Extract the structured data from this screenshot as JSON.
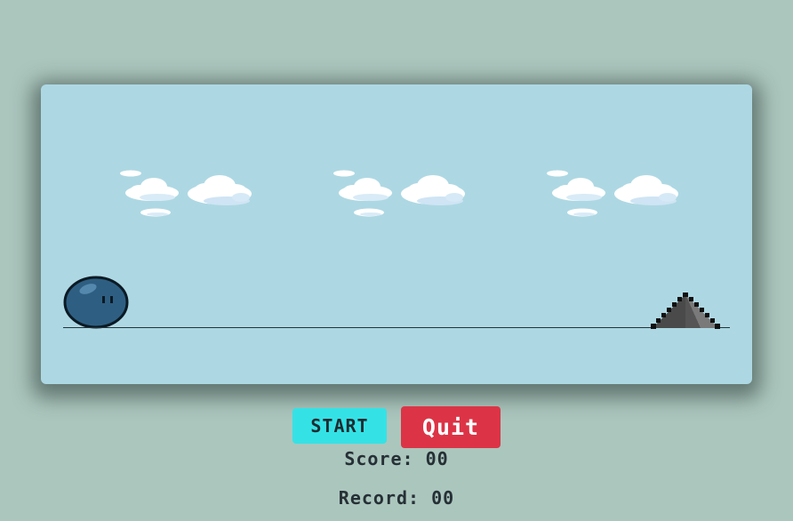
{
  "game": {
    "player": "blue-slime",
    "obstacle": "gray-spike",
    "colors": {
      "background": "#abc6bd",
      "sky": "#add8e3",
      "player": "#2e5f82",
      "obstacle": "#555555",
      "start_button": "#34e2e6",
      "quit_button": "#dc3446"
    }
  },
  "controls": {
    "start_label": "START",
    "quit_label": "Quit"
  },
  "stats": {
    "score_text": "Score: 00",
    "record_text": "Record: 00"
  }
}
